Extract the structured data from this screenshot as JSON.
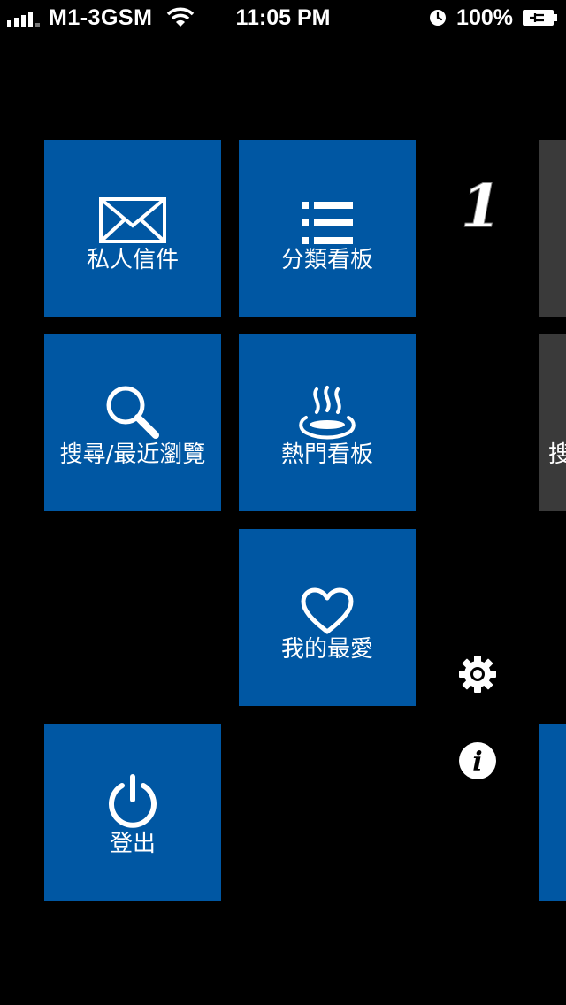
{
  "status_bar": {
    "carrier": "M1-3GSM",
    "time": "11:05 PM",
    "battery": "100%"
  },
  "tiles": {
    "mail": {
      "label": "私人信件",
      "icon": "envelope-icon"
    },
    "categories": {
      "label": "分類看板",
      "icon": "list-icon"
    },
    "search": {
      "label": "搜尋/最近瀏覽",
      "icon": "magnifier-icon"
    },
    "hot": {
      "label": "熱門看板",
      "icon": "hot-spring-icon"
    },
    "favorites": {
      "label": "我的最愛",
      "icon": "heart-icon"
    },
    "logout": {
      "label": "登出",
      "icon": "power-icon"
    }
  },
  "side": {
    "logo": "1",
    "settings_icon": "gear-icon",
    "info_icon": "info-icon"
  },
  "next_page_peek": {
    "tile_text": "搜"
  },
  "colors": {
    "tile_blue": "#0057a3",
    "tile_gray": "#3a3a3a",
    "background": "#000000"
  }
}
